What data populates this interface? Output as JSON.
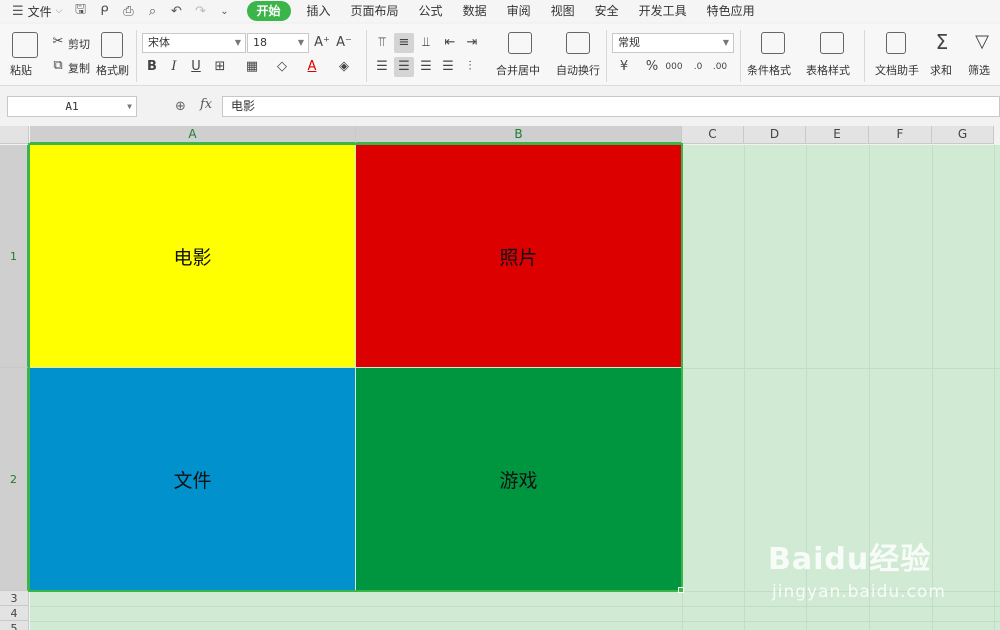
{
  "menubar": {
    "file_label": "文件",
    "tabs": [
      "开始",
      "插入",
      "页面布局",
      "公式",
      "数据",
      "审阅",
      "视图",
      "安全",
      "开发工具",
      "特色应用"
    ],
    "active_tab": "开始"
  },
  "ribbon": {
    "paste_label": "粘贴",
    "cut_label": "剪切",
    "copy_label": "复制",
    "format_painter_label": "格式刷",
    "font_name": "宋体",
    "font_size": "18",
    "merge_center_label": "合并居中",
    "wrap_text_label": "自动换行",
    "number_format": "常规",
    "conditional_format_label": "条件格式",
    "table_style_label": "表格样式",
    "doc_assistant_label": "文档助手",
    "sum_label": "求和",
    "filter_label": "筛选"
  },
  "formula_bar": {
    "name_box": "A1",
    "fx": "fx",
    "content": "电影"
  },
  "columns": [
    "A",
    "B",
    "C",
    "D",
    "E",
    "F",
    "G"
  ],
  "rows": [
    "1",
    "2",
    "3",
    "4",
    "5"
  ],
  "cells": {
    "a1": {
      "text": "电影",
      "color": "#ffff00"
    },
    "b1": {
      "text": "照片",
      "color": "#dd0000"
    },
    "a2": {
      "text": "文件",
      "color": "#0191cc"
    },
    "b2": {
      "text": "游戏",
      "color": "#009640"
    }
  },
  "watermark": {
    "logo": "Baidu经验",
    "url": "jingyan.baidu.com"
  },
  "colors": {
    "accent": "#3bb54a",
    "selection_shade": "#d0ead3"
  }
}
